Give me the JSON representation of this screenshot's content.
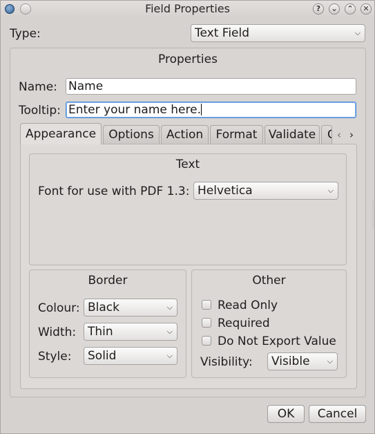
{
  "window": {
    "title": "Field Properties"
  },
  "type_row": {
    "label": "Type:",
    "value": "Text Field"
  },
  "properties": {
    "title": "Properties",
    "name_label": "Name:",
    "name_value": "Name",
    "tooltip_label": "Tooltip:",
    "tooltip_value": "Enter your name here."
  },
  "tabs": [
    {
      "label": "Appearance",
      "active": true
    },
    {
      "label": "Options"
    },
    {
      "label": "Action"
    },
    {
      "label": "Format"
    },
    {
      "label": "Validate"
    },
    {
      "label": "C"
    }
  ],
  "text_group": {
    "title": "Text",
    "font_label": "Font for use with PDF 1.3:",
    "font_value": "Helvetica"
  },
  "border_group": {
    "title": "Border",
    "colour_label": "Colour:",
    "colour_value": "Black",
    "width_label": "Width:",
    "width_value": "Thin",
    "style_label": "Style:",
    "style_value": "Solid"
  },
  "other_group": {
    "title": "Other",
    "checkboxes": [
      {
        "label": "Read Only",
        "checked": false
      },
      {
        "label": "Required",
        "checked": false
      },
      {
        "label": "Do Not Export Value",
        "checked": false
      }
    ],
    "visibility_label": "Visibility:",
    "visibility_value": "Visible"
  },
  "buttons": {
    "ok": "OK",
    "cancel": "Cancel"
  },
  "icons": {
    "dropdown": "chevron-down-icon",
    "help": "help-icon",
    "minimize": "minimize-icon",
    "maximize": "maximize-icon",
    "close": "close-icon",
    "tab_prev": "chevron-left-icon",
    "tab_next": "chevron-right-icon"
  },
  "colors": {
    "window_bg": "#d6d2d0",
    "focus": "#4a8ad6"
  }
}
